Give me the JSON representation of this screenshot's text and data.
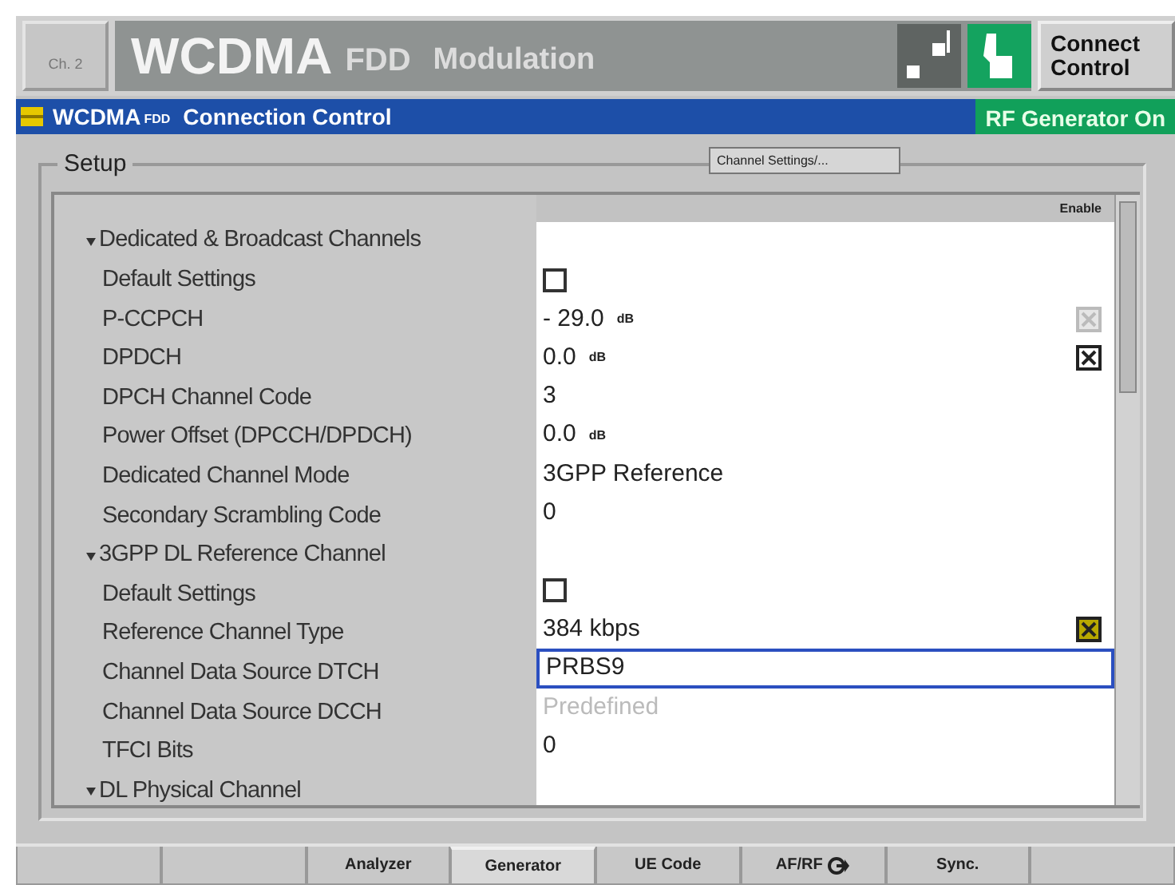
{
  "title_bar": {
    "channel_button": "Ch. 2",
    "app": "WCDMA",
    "app_suffix": "FDD",
    "mode": "Modulation",
    "control_button": "Connect Control"
  },
  "panel_bar": {
    "title": "WCDMA",
    "title_suffix": "FDD",
    "subtitle": "Connection Control",
    "status": "RF Generator On"
  },
  "setup": {
    "title": "Setup",
    "settings_button": "Channel Settings/...",
    "enable_header": "Enable",
    "rows": [
      {
        "kind": "header",
        "label": "Dedicated & Broadcast Channels"
      },
      {
        "kind": "checkbox",
        "label": "Default Settings",
        "checked": false
      },
      {
        "kind": "value",
        "label": "P-CCPCH",
        "value": "- 29.0",
        "unit": "dB",
        "enable": {
          "checked": true,
          "disabled": true,
          "highlighted": false
        }
      },
      {
        "kind": "value",
        "label": "DPDCH",
        "value": "0.0",
        "unit": "dB",
        "enable": {
          "checked": true,
          "disabled": false,
          "highlighted": false
        }
      },
      {
        "kind": "value",
        "label": "DPCH Channel Code",
        "value": "3"
      },
      {
        "kind": "value",
        "label": "Power Offset (DPCCH/DPDCH)",
        "value": "0.0",
        "unit": "dB"
      },
      {
        "kind": "value",
        "label": "Dedicated Channel Mode",
        "value": "3GPP Reference"
      },
      {
        "kind": "value",
        "label": "Secondary Scrambling Code",
        "value": "0"
      },
      {
        "kind": "header",
        "label": "3GPP DL Reference Channel"
      },
      {
        "kind": "checkbox",
        "label": "Default Settings",
        "checked": false
      },
      {
        "kind": "value",
        "label": "Reference Channel Type",
        "value": "384 kbps",
        "enable": {
          "checked": true,
          "disabled": false,
          "highlighted": true
        }
      },
      {
        "kind": "value",
        "label": "Channel Data Source DTCH",
        "value": "PRBS9",
        "selected": true
      },
      {
        "kind": "value",
        "label": "Channel Data Source DCCH",
        "value": "Predefined",
        "disabled": true
      },
      {
        "kind": "value",
        "label": "TFCI Bits",
        "value": "0"
      },
      {
        "kind": "header",
        "label": "DL Physical Channel"
      }
    ]
  },
  "tabs": [
    {
      "selected": false
    },
    {
      "selected": false
    },
    {
      "label": "Analyzer",
      "selected": false
    },
    {
      "label": "Generator",
      "selected": true
    },
    {
      "label": "UE Code",
      "selected": false
    },
    {
      "label": "AF/RF",
      "selected": false,
      "icon": true
    },
    {
      "label": "Sync.",
      "selected": false
    },
    {
      "selected": false
    }
  ]
}
